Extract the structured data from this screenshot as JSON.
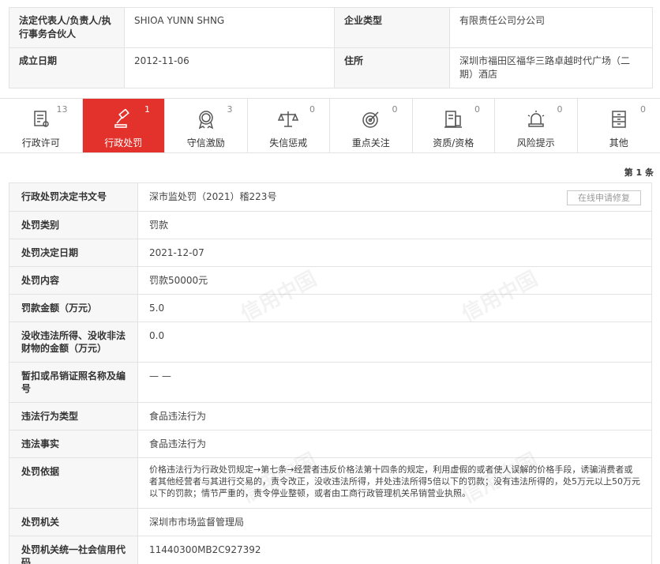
{
  "info": {
    "rows": [
      {
        "label1": "法定代表人/负责人/执行事务合伙人",
        "value1": "SHIOA YUNN SHNG",
        "label2": "企业类型",
        "value2": "有限责任公司分公司"
      },
      {
        "label1": "成立日期",
        "value1": "2012-11-06",
        "label2": "住所",
        "value2": "深圳市福田区福华三路卓越时代广场（二期）酒店"
      }
    ]
  },
  "tabs": [
    {
      "label": "行政许可",
      "count": "13",
      "icon": "license-icon",
      "active": false
    },
    {
      "label": "行政处罚",
      "count": "1",
      "icon": "gavel-icon",
      "active": true
    },
    {
      "label": "守信激励",
      "count": "3",
      "icon": "honor-badge-icon",
      "active": false
    },
    {
      "label": "失信惩戒",
      "count": "0",
      "icon": "scale-icon",
      "active": false
    },
    {
      "label": "重点关注",
      "count": "0",
      "icon": "target-icon",
      "active": false
    },
    {
      "label": "资质/资格",
      "count": "0",
      "icon": "certificate-icon",
      "active": false
    },
    {
      "label": "风险提示",
      "count": "0",
      "icon": "alarm-icon",
      "active": false
    },
    {
      "label": "其他",
      "count": "0",
      "icon": "cabinet-icon",
      "active": false
    }
  ],
  "page_count": "第 1 条",
  "repair_button": "在线申请修复",
  "watermark": "信用中国",
  "detail": [
    {
      "label": "行政处罚决定书文号",
      "value": "深市监处罚（2021）稽223号"
    },
    {
      "label": "处罚类别",
      "value": "罚款"
    },
    {
      "label": "处罚决定日期",
      "value": "2021-12-07"
    },
    {
      "label": "处罚内容",
      "value": "罚款50000元"
    },
    {
      "label": "罚款金额（万元）",
      "value": "5.0"
    },
    {
      "label": "没收违法所得、没收非法财物的金额（万元）",
      "value": "0.0"
    },
    {
      "label": "暂扣或吊销证照名称及编号",
      "value": "— —"
    },
    {
      "label": "违法行为类型",
      "value": "食品违法行为"
    },
    {
      "label": "违法事实",
      "value": "食品违法行为"
    },
    {
      "label": "处罚依据",
      "value": "价格违法行为行政处罚规定→第七条→经营者违反价格法第十四条的规定，利用虚假的或者使人误解的价格手段，诱骗消费者或者其他经营者与其进行交易的，责令改正，没收违法所得，并处违法所得5倍以下的罚款；没有违法所得的，处5万元以上50万元以下的罚款；情节严重的，责令停业整顿，或者由工商行政管理机关吊销营业执照。"
    },
    {
      "label": "处罚机关",
      "value": "深圳市市场监督管理局"
    },
    {
      "label": "处罚机关统一社会信用代码",
      "value": "11440300MB2C927392"
    }
  ]
}
